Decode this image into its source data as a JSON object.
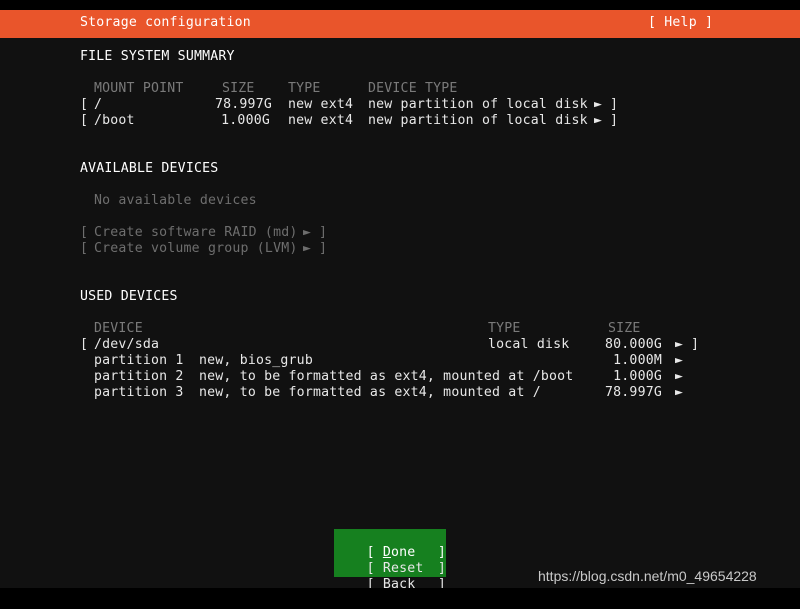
{
  "header": {
    "title": "Storage configuration",
    "help_label": "[ Help ]",
    "bar_color": "#e9552b"
  },
  "filesystem_summary": {
    "heading": "FILE SYSTEM SUMMARY",
    "columns": {
      "mount_point": "MOUNT POINT",
      "size": "SIZE",
      "type": "TYPE",
      "device_type": "DEVICE TYPE"
    },
    "rows": [
      {
        "open_bracket": "[",
        "mount_point": "/",
        "size": "78.997G",
        "type": "new ext4",
        "device_type": "new partition of local disk",
        "arrow": "►",
        "close_bracket": "]"
      },
      {
        "open_bracket": "[",
        "mount_point": "/boot",
        "size": "1.000G",
        "type": "new ext4",
        "device_type": "new partition of local disk",
        "arrow": "►",
        "close_bracket": "]"
      }
    ]
  },
  "available_devices": {
    "heading": "AVAILABLE DEVICES",
    "empty_message": "No available devices",
    "actions": [
      {
        "open_bracket": "[",
        "label": "Create software RAID (md)",
        "arrow": "►",
        "close_bracket": "]"
      },
      {
        "open_bracket": "[",
        "label": "Create volume group (LVM)",
        "arrow": "►",
        "close_bracket": "]"
      }
    ]
  },
  "used_devices": {
    "heading": "USED DEVICES",
    "columns": {
      "device": "DEVICE",
      "type": "TYPE",
      "size": "SIZE"
    },
    "disk": {
      "open_bracket": "[",
      "device": "/dev/sda",
      "type": "local disk",
      "size": "80.000G",
      "arrow": "►",
      "close_bracket": "]"
    },
    "partitions": [
      {
        "name": "partition 1",
        "description": "new, bios_grub",
        "size": "1.000M",
        "arrow": "►"
      },
      {
        "name": "partition 2",
        "description": "new, to be formatted as ext4, mounted at /boot",
        "size": "1.000G",
        "arrow": "►"
      },
      {
        "name": "partition 3",
        "description": "new, to be formatted as ext4, mounted at /",
        "size": "78.997G",
        "arrow": "►"
      }
    ]
  },
  "buttons": [
    {
      "open_bracket": "[",
      "accel": "D",
      "rest": "one",
      "close_bracket": "]",
      "selected": true,
      "highlight_color": "#16801f"
    },
    {
      "open_bracket": "[",
      "accel": "R",
      "rest": "eset",
      "close_bracket": "]",
      "selected": false
    },
    {
      "open_bracket": "[",
      "accel": "B",
      "rest": "ack",
      "close_bracket": "]",
      "selected": false
    }
  ],
  "watermark": {
    "text": "https://blog.csdn.net/m0_49654228"
  }
}
